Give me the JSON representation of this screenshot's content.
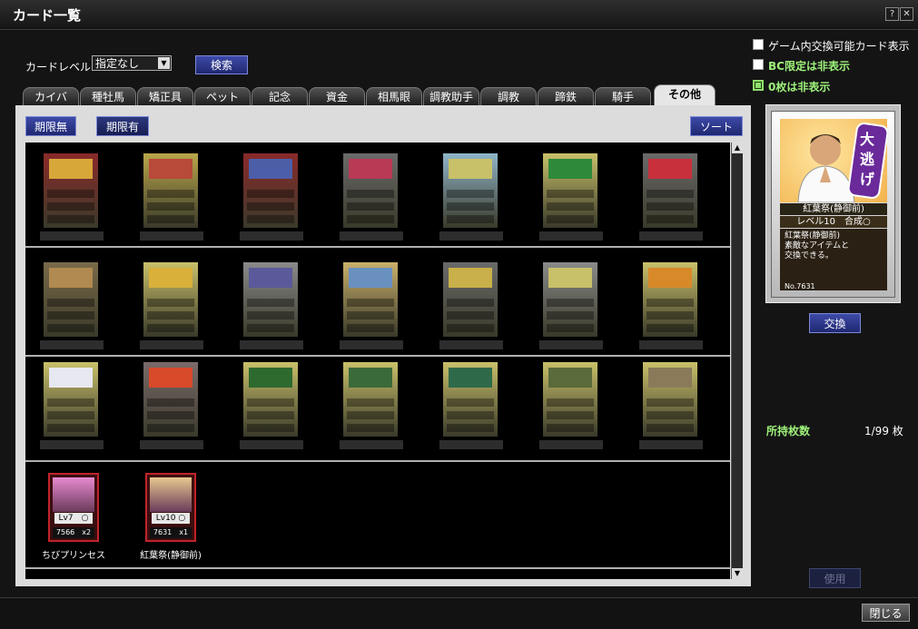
{
  "window": {
    "title": "カード一覧",
    "help_label": "?",
    "close_label": "✕"
  },
  "filter": {
    "level_label": "カードレベル:",
    "level_value": "指定なし",
    "search_label": "検索"
  },
  "checkboxes": [
    {
      "label": "ゲーム内交換可能カード表示",
      "checked": false,
      "color": "#ffffff"
    },
    {
      "label": "BC限定は非表示",
      "checked": false,
      "color": "#9ef27a"
    },
    {
      "label": "0枚は非表示",
      "checked": true,
      "color": "#9ef27a"
    }
  ],
  "tabs": [
    {
      "label": "カイバ",
      "active": false
    },
    {
      "label": "種牡馬",
      "active": false
    },
    {
      "label": "矯正具",
      "active": false
    },
    {
      "label": "ペット",
      "active": false
    },
    {
      "label": "記念",
      "active": false
    },
    {
      "label": "資金",
      "active": false
    },
    {
      "label": "相馬眼",
      "active": false
    },
    {
      "label": "調教助手",
      "active": false
    },
    {
      "label": "調教",
      "active": false
    },
    {
      "label": "蹄鉄",
      "active": false
    },
    {
      "label": "騎手",
      "active": false
    },
    {
      "label": "その他",
      "active": true
    }
  ],
  "subfilter": {
    "no_limit_label": "期限無",
    "limit_label": "期限有",
    "sort_label": "ソート"
  },
  "grid_cards": [
    {
      "accent": "#d8a73a",
      "frame": "#8a2a2a"
    },
    {
      "accent": "#b84a3a",
      "frame": "#b9a64a"
    },
    {
      "accent": "#4c5ea8",
      "frame": "#8a2a2a"
    },
    {
      "accent": "#b83a55",
      "frame": "#6a6a6a"
    },
    {
      "accent": "#c9c06a",
      "frame": "#8fb5c9"
    },
    {
      "accent": "#2e8a3a",
      "frame": "#c9c06a"
    },
    {
      "accent": "#c8303c",
      "frame": "#6a6a6a"
    },
    {
      "accent": "#b08a50",
      "frame": "#7a6a4a"
    },
    {
      "accent": "#d8b03a",
      "frame": "#c9c06a"
    },
    {
      "accent": "#5a5a9a",
      "frame": "#8a8a8a"
    },
    {
      "accent": "#6a90c0",
      "frame": "#c9b06a"
    },
    {
      "accent": "#c9b04a",
      "frame": "#6a6a6a"
    },
    {
      "accent": "#c9c06a",
      "frame": "#8a8a8a"
    },
    {
      "accent": "#d88a2a",
      "frame": "#c9c06a"
    },
    {
      "accent": "#e8e8f0",
      "frame": "#c9c06a"
    },
    {
      "accent": "#d84a2a",
      "frame": "#7a6a6a"
    },
    {
      "accent": "#2e6a2e",
      "frame": "#c9c06a"
    },
    {
      "accent": "#3a6a3a",
      "frame": "#c9c06a"
    },
    {
      "accent": "#2e6a4a",
      "frame": "#c9c06a"
    },
    {
      "accent": "#5a6a3a",
      "frame": "#c9c06a"
    },
    {
      "accent": "#8a7a5a",
      "frame": "#c9c06a"
    }
  ],
  "owned_cards": [
    {
      "name": "ちびプリンセス",
      "level": "Lv7　○",
      "number": "7566　x2",
      "art": "#e88ad0"
    },
    {
      "name": "紅葉祭(静御前)",
      "level": "Lv10 ○",
      "number": "7631　x1",
      "art": "#e8c890"
    }
  ],
  "preview": {
    "art_text": "大逃げ",
    "name": "紅葉祭(静御前)",
    "level": "レベル10　合成○",
    "description": "紅葉祭(静御前)\n素敵なアイテムと\n交換できる。",
    "number": "No.7631"
  },
  "exchange_label": "交換",
  "owned": {
    "label": "所持枚数",
    "value": "1/99 枚"
  },
  "use_label": "使用",
  "close_label": "閉じる"
}
